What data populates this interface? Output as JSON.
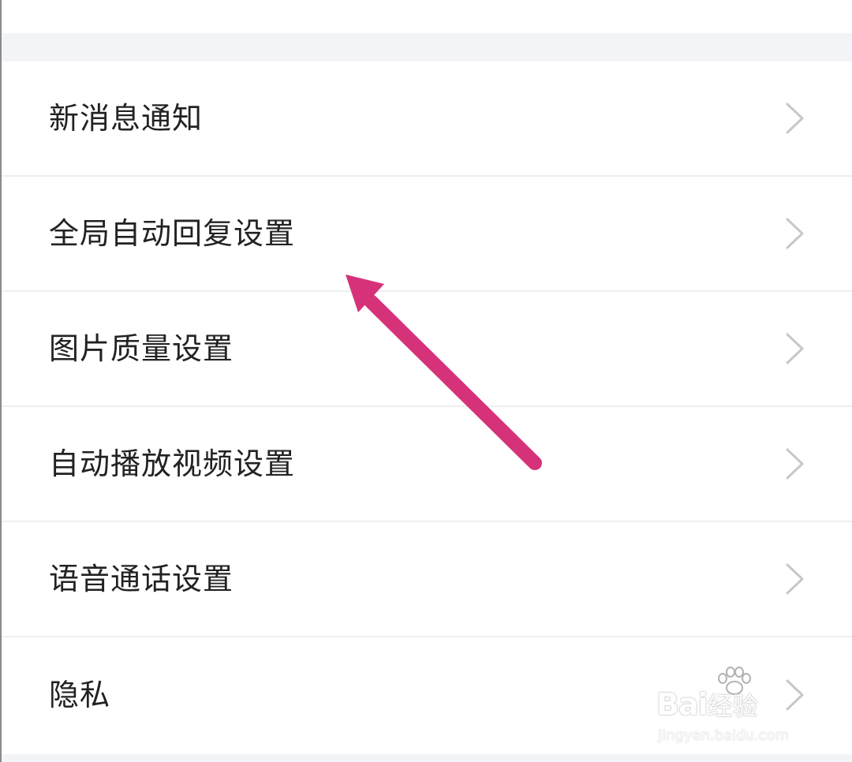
{
  "settings_menu": {
    "items": [
      {
        "label": "新消息通知"
      },
      {
        "label": "全局自动回复设置"
      },
      {
        "label": "图片质量设置"
      },
      {
        "label": "自动播放视频设置"
      },
      {
        "label": "语音通话设置"
      },
      {
        "label": "隐私"
      }
    ],
    "chevron_icon": "chevron-right-icon"
  },
  "annotation": {
    "arrow_color": "#d6327a",
    "target": "全局自动回复设置"
  },
  "watermark": {
    "brand": "Bai",
    "brand_suffix": "经验",
    "domain": "jingyan.baidu.com"
  },
  "colors": {
    "background": "#ffffff",
    "section_gap": "#f3f4f8",
    "divider": "#efeff2",
    "chevron": "#c7c7cc",
    "text": "#222222"
  }
}
